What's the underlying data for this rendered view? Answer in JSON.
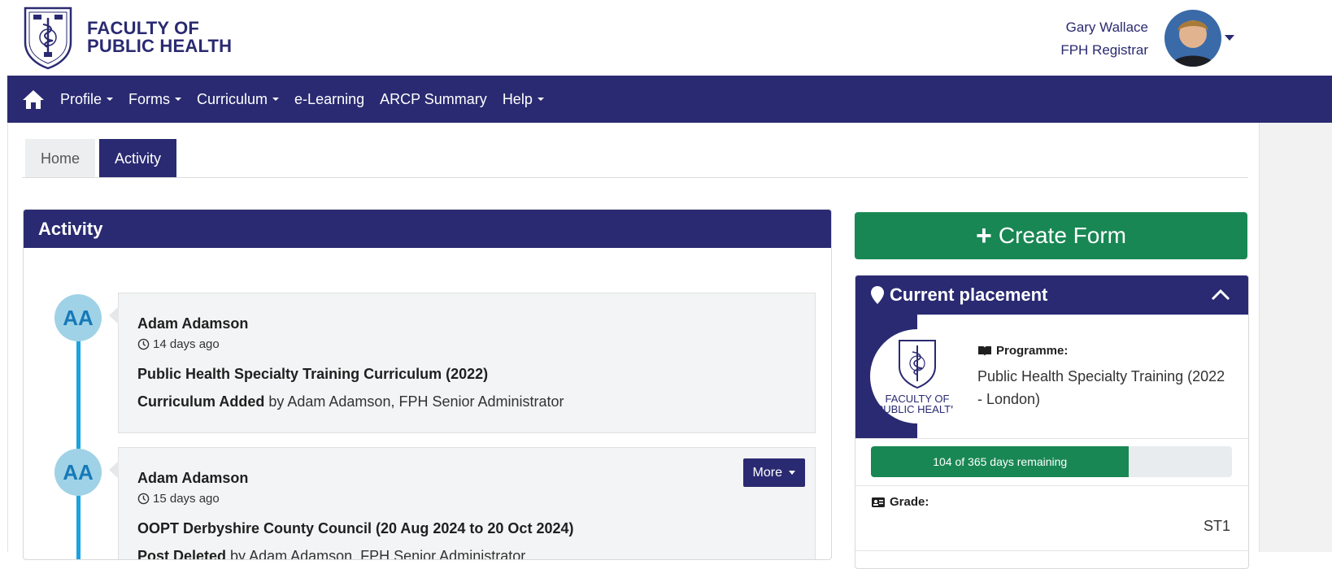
{
  "header": {
    "logo_line1": "FACULTY OF",
    "logo_line2": "PUBLIC HEALTH",
    "user_name": "Gary Wallace",
    "user_role": "FPH Registrar"
  },
  "nav": {
    "items": [
      {
        "label": "Profile",
        "dropdown": true
      },
      {
        "label": "Forms",
        "dropdown": true
      },
      {
        "label": "Curriculum",
        "dropdown": true
      },
      {
        "label": "e-Learning",
        "dropdown": false
      },
      {
        "label": "ARCP Summary",
        "dropdown": false
      },
      {
        "label": "Help",
        "dropdown": true
      }
    ]
  },
  "tabs": [
    {
      "label": "Home",
      "active": false
    },
    {
      "label": "Activity",
      "active": true
    }
  ],
  "activity": {
    "title": "Activity",
    "items": [
      {
        "initials": "AA",
        "name": "Adam Adamson",
        "time": "14 days ago",
        "title": "Public Health Specialty Training Curriculum (2022)",
        "action": "Curriculum Added",
        "by": "by Adam Adamson, FPH Senior Administrator"
      },
      {
        "initials": "AA",
        "name": "Adam Adamson",
        "time": "15 days ago",
        "title": "OOPT Derbyshire County Council (20 Aug 2024 to 20 Oct 2024)",
        "action": "Post Deleted",
        "by": "by Adam Adamson, FPH Senior Administrator",
        "more_label": "More"
      }
    ]
  },
  "create_form": {
    "label": "Create Form"
  },
  "placement": {
    "title": "Current placement",
    "logo_line1": "FACULTY OF",
    "logo_line2": "PUBLIC HEALTH",
    "programme_label": "Programme:",
    "programme_value": "Public Health Specialty Training (2022 - London)",
    "progress_text": "104 of 365 days remaining",
    "progress_fraction": 0.715,
    "grade_label": "Grade:",
    "grade_value": "ST1"
  },
  "colors": {
    "brand_navy": "#2a2a72",
    "success_green": "#198754",
    "timeline_blue": "#1aa3e0"
  }
}
